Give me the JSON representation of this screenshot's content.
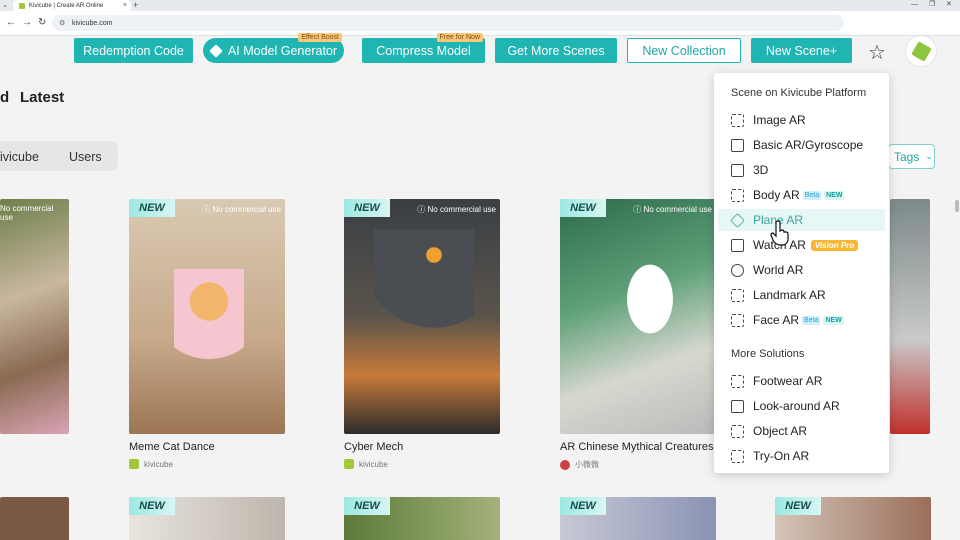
{
  "browser": {
    "tab_title": "Kivicube | Create AR Online",
    "url": "kivicube.com",
    "new_tab": "+",
    "tab_close": "×",
    "tab_menu": "⌄"
  },
  "toolbar": {
    "redemption": "Redemption Code",
    "ai_generator": "AI Model Generator",
    "ai_badge": "Effect Boost",
    "compress": "Compress Model",
    "compress_badge": "Free for Now",
    "more_scenes": "Get More Scenes",
    "new_collection": "New Collection",
    "new_scene": "New Scene+"
  },
  "page": {
    "heading_partial": "d",
    "heading_latest": "Latest",
    "filter_kivicube": "ivicube",
    "filter_users": "Users",
    "tags": "Tags"
  },
  "cards": [
    {
      "badge": "",
      "no_commercial": "No commercial use",
      "title": "",
      "author": ""
    },
    {
      "badge": "NEW",
      "no_commercial": "No commercial use",
      "title": "Meme Cat Dance",
      "author": "kivicube"
    },
    {
      "badge": "NEW",
      "no_commercial": "No commercial use",
      "title": "Cyber Mech",
      "author": "kivicube"
    },
    {
      "badge": "NEW",
      "no_commercial": "No commercial use",
      "title": "AR Chinese Mythical Creatures",
      "author": "小微微"
    }
  ],
  "row2_badges": [
    "NEW",
    "NEW",
    "NEW",
    "NEW"
  ],
  "menu": {
    "section1": "Scene on Kivicube Platform",
    "items1": [
      {
        "label": "Image AR"
      },
      {
        "label": "Basic AR/Gyroscope"
      },
      {
        "label": "3D"
      },
      {
        "label": "Body AR",
        "beta": "Beta",
        "new": "NEW"
      },
      {
        "label": "Plane AR"
      },
      {
        "label": "Watch AR",
        "vp": "Vision Pro"
      },
      {
        "label": "World AR"
      },
      {
        "label": "Landmark AR"
      },
      {
        "label": "Face AR",
        "beta": "Beta",
        "new": "NEW"
      }
    ],
    "section2": "More Solutions",
    "items2": [
      {
        "label": "Footwear AR"
      },
      {
        "label": "Look-around AR"
      },
      {
        "label": "Object AR"
      },
      {
        "label": "Try-On AR"
      }
    ]
  },
  "colors": {
    "accent": "#1fb5b3",
    "hover": "#e6f7f6"
  }
}
